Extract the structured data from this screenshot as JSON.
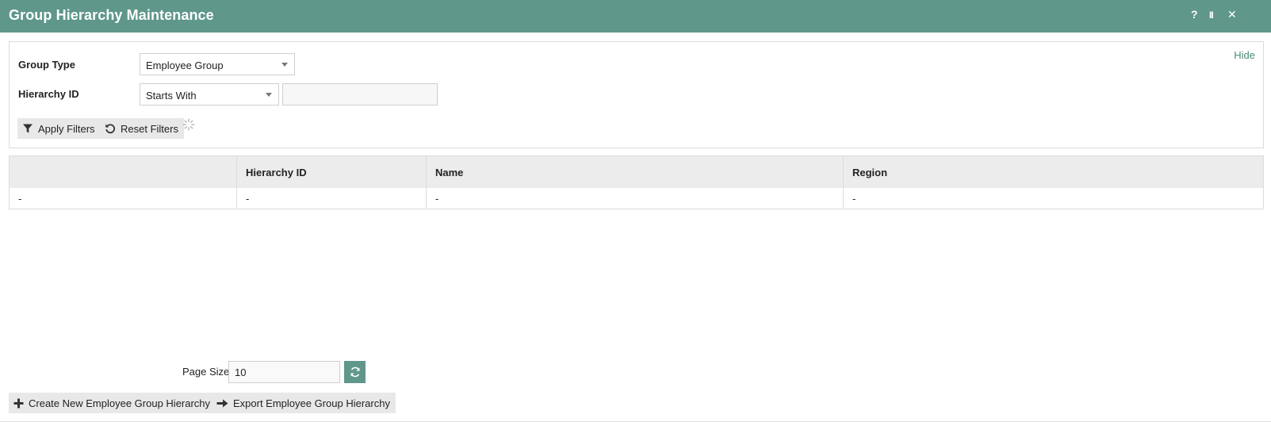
{
  "window": {
    "title": "Group Hierarchy Maintenance",
    "controls": {
      "help": "?",
      "pause": "II",
      "close": "✕"
    }
  },
  "filters": {
    "hide_label": "Hide",
    "group_type": {
      "label": "Group Type",
      "value": "Employee Group"
    },
    "hierarchy_id": {
      "label": "Hierarchy ID",
      "operator": "Starts With",
      "value": ""
    },
    "apply_label": "Apply Filters",
    "reset_label": "Reset Filters"
  },
  "grid": {
    "columns": [
      "",
      "Hierarchy ID",
      "Name",
      "Region"
    ],
    "rows": [
      [
        "-",
        "-",
        "-",
        "-"
      ]
    ]
  },
  "pagination": {
    "page_size_label": "Page Size",
    "page_size": "10"
  },
  "actions": {
    "create_label": "Create New Employee Group Hierarchy",
    "export_label": "Export Employee Group Hierarchy"
  },
  "colors": {
    "accent": "#5f978a",
    "link": "#4c8a7c"
  },
  "icons": [
    "help-icon",
    "pause-icon",
    "close-icon",
    "filter-icon",
    "reset-icon",
    "spinner-icon",
    "refresh-icon",
    "plus-icon",
    "arrow-right-icon"
  ]
}
